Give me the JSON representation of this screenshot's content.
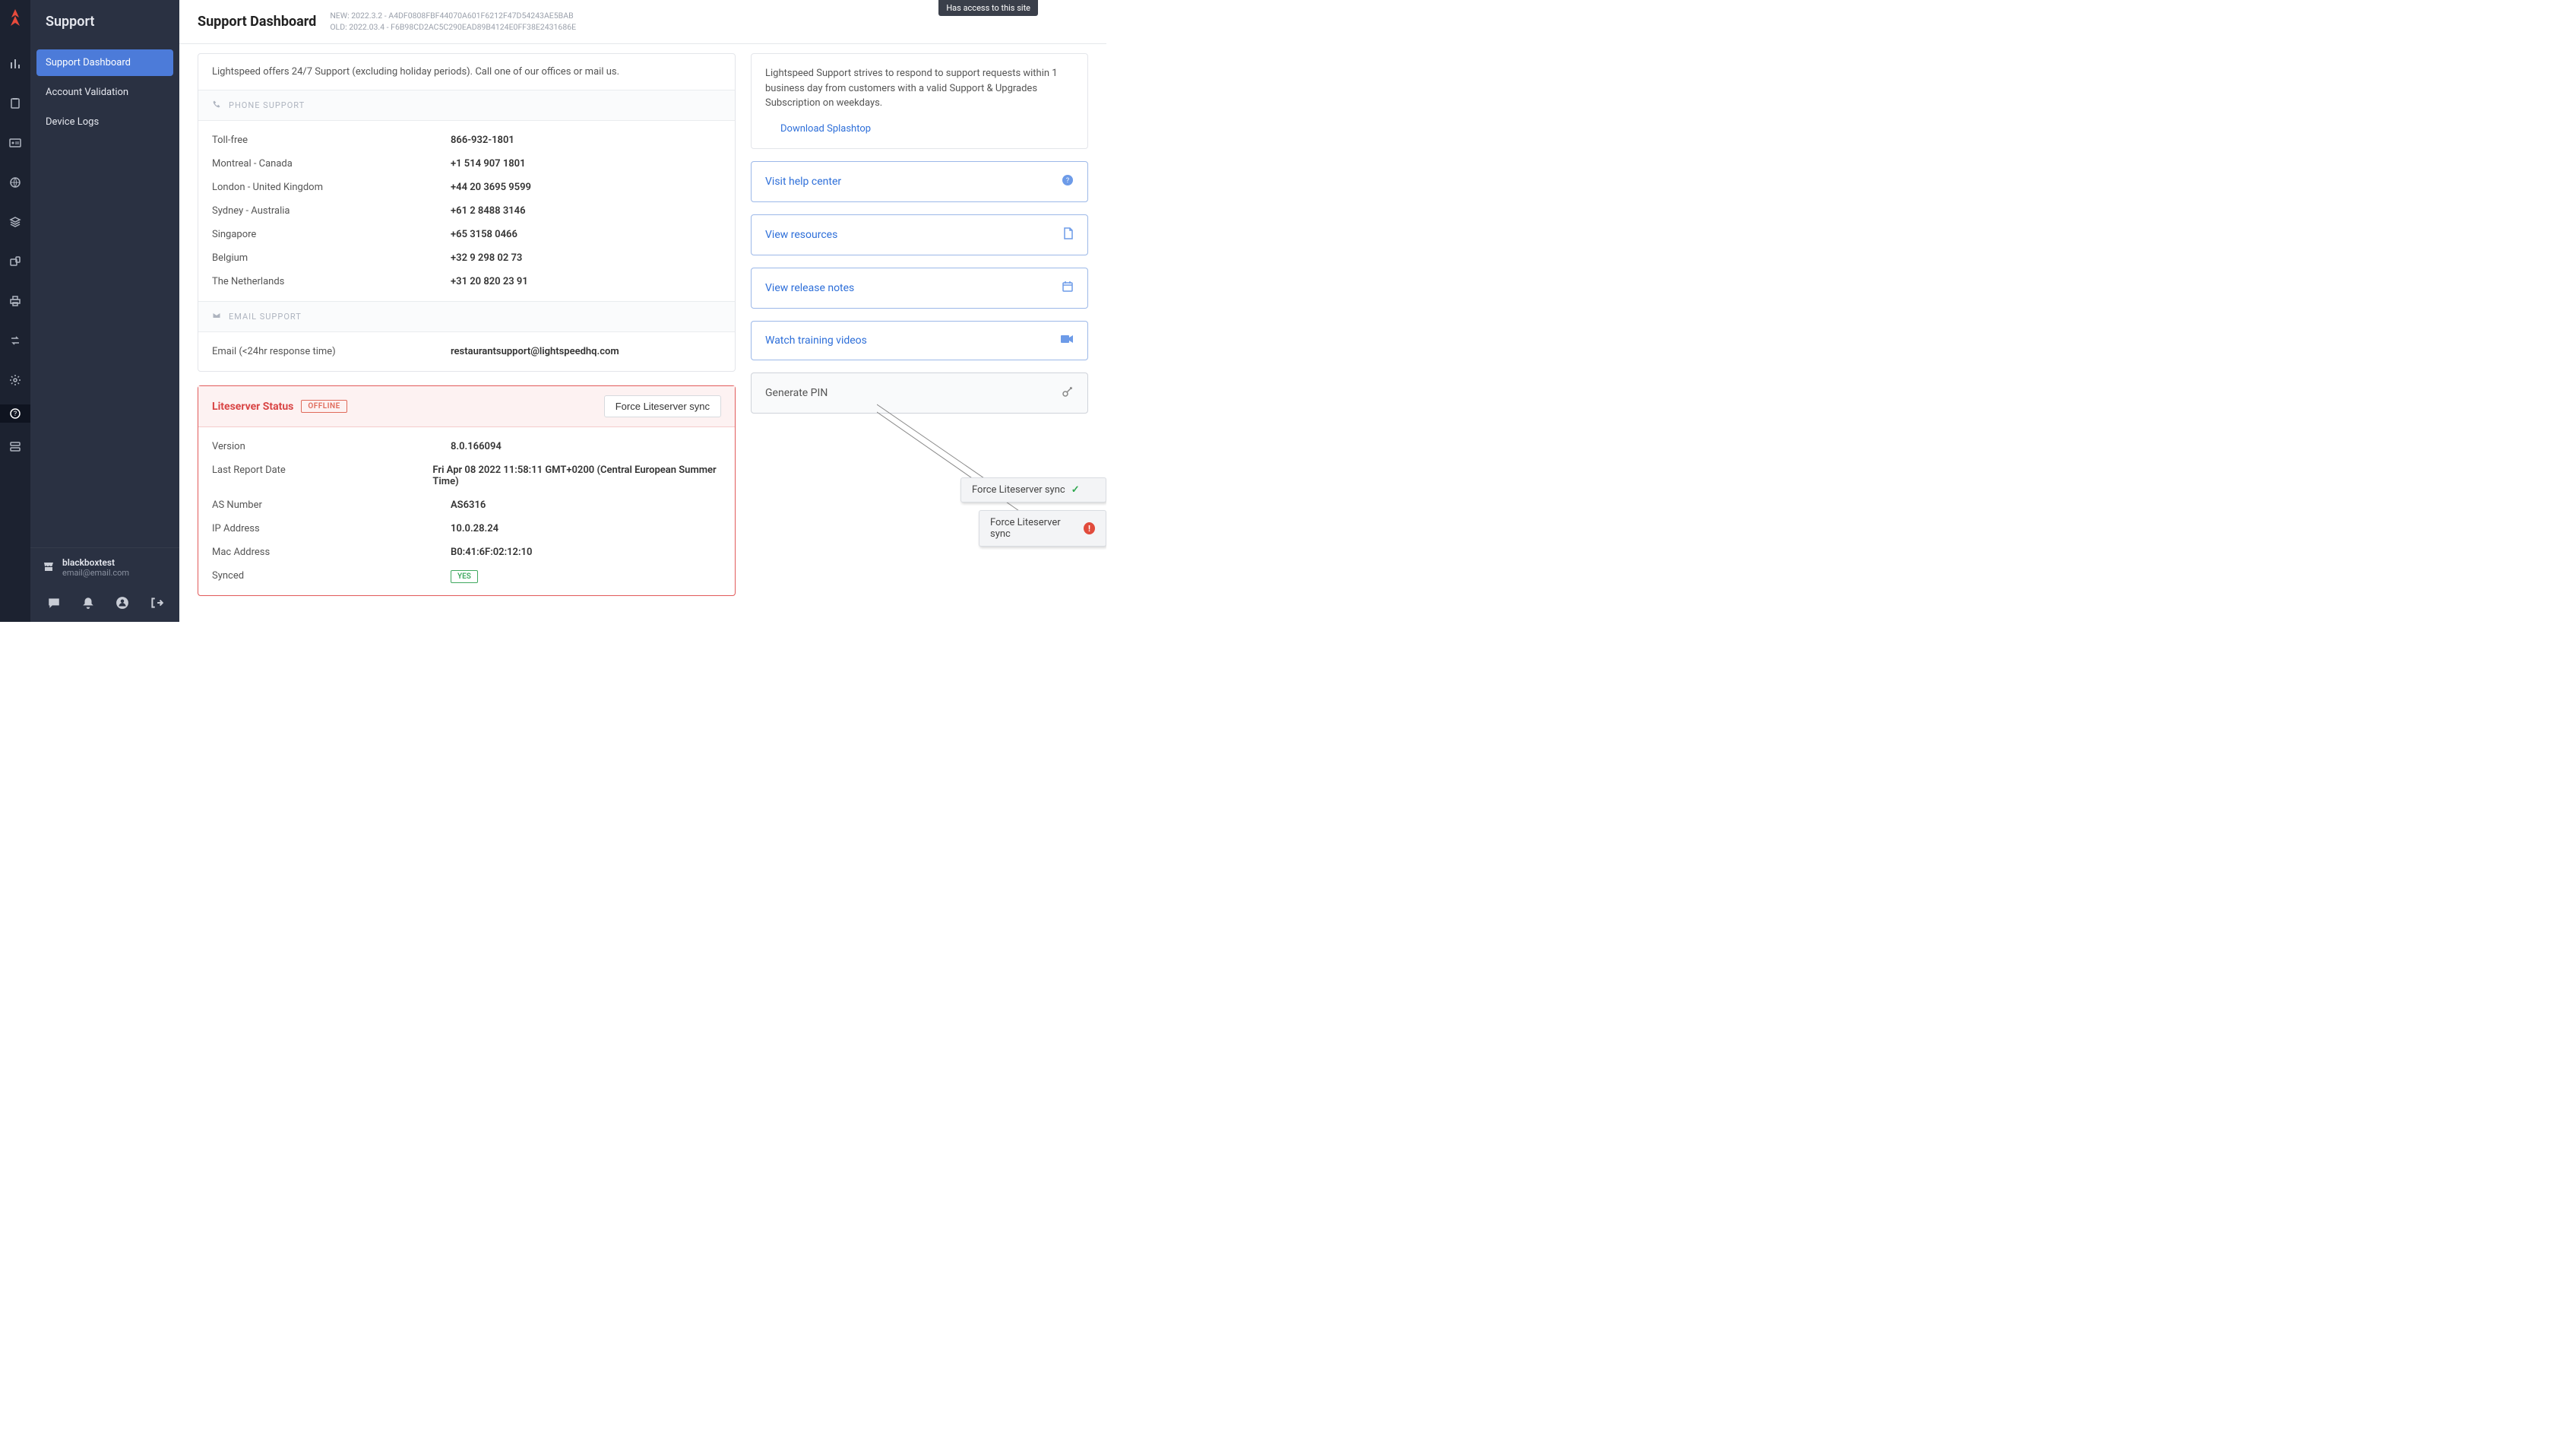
{
  "tooltip": "Has access to this site",
  "app_title": "Support",
  "sidebar_items": [
    "Support Dashboard",
    "Account Validation",
    "Device Logs"
  ],
  "user": {
    "name": "blackboxtest",
    "email": "email@email.com"
  },
  "header": {
    "title": "Support Dashboard",
    "meta_new": "NEW: 2022.3.2 - A4DF0808FBF44070A601F6212F47D54243AE5BAB",
    "meta_old": "OLD: 2022.03.4 - F6B98CD2AC5C290EAD89B4124E0FF38E2431686E"
  },
  "support_intro": "Lightspeed offers 24/7 Support (excluding holiday periods). Call one of our offices or mail us.",
  "phone_section": "PHONE SUPPORT",
  "phones": [
    {
      "label": "Toll-free",
      "value": "866-932-1801"
    },
    {
      "label": "Montreal - Canada",
      "value": "+1 514 907 1801"
    },
    {
      "label": "London - United Kingdom",
      "value": "+44 20 3695 9599"
    },
    {
      "label": "Sydney - Australia",
      "value": "+61 2 8488 3146"
    },
    {
      "label": "Singapore",
      "value": "+65 3158 0466"
    },
    {
      "label": "Belgium",
      "value": "+32 9 298 02 73"
    },
    {
      "label": "The Netherlands",
      "value": "+31 20 820 23 91"
    }
  ],
  "email_section": "EMAIL SUPPORT",
  "email": {
    "label": "Email (<24hr response time)",
    "value": "restaurantsupport@lightspeedhq.com"
  },
  "lite": {
    "title": "Liteserver Status",
    "status": "OFFLINE",
    "sync_btn": "Force Liteserver sync",
    "rows": [
      {
        "label": "Version",
        "value": "8.0.166094"
      },
      {
        "label": "Last Report Date",
        "value": "Fri Apr 08 2022 11:58:11 GMT+0200 (Central European Summer Time)"
      },
      {
        "label": "AS Number",
        "value": "AS6316"
      },
      {
        "label": "IP Address",
        "value": "10.0.28.24"
      },
      {
        "label": "Mac Address",
        "value": "B0:41:6F:02:12:10"
      },
      {
        "label": "Synced",
        "value": "YES",
        "badge": true
      }
    ]
  },
  "remote_intro": "Lightspeed Support strives to respond to support requests within 1 business day from customers with a valid Support & Upgrades Subscription on weekdays.",
  "dl": "Download Splashtop",
  "links": [
    {
      "label": "Visit help center",
      "icon": "?"
    },
    {
      "label": "View resources",
      "icon": "doc"
    },
    {
      "label": "View release notes",
      "icon": "cal"
    },
    {
      "label": "Watch training videos",
      "icon": "vid"
    }
  ],
  "gen_pin": "Generate PIN",
  "float": [
    {
      "label": "Force Liteserver sync",
      "state": "ok"
    },
    {
      "label": "Force Liteserver sync",
      "state": "err"
    }
  ]
}
